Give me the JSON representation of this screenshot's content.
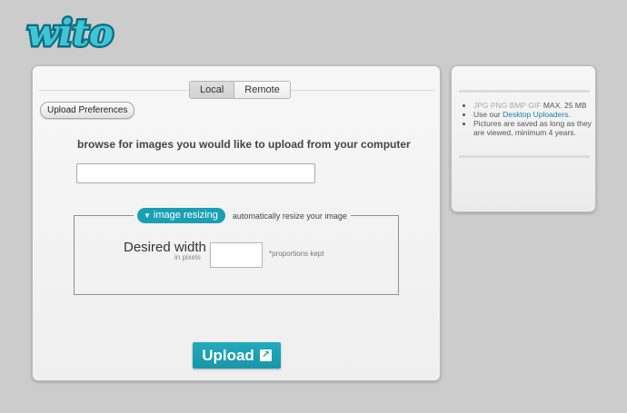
{
  "logo": {
    "text": "wito"
  },
  "tabs": [
    {
      "label": "Local",
      "active": true
    },
    {
      "label": "Remote",
      "active": false
    }
  ],
  "upload_preferences": "Upload Preferences",
  "browse_label": "browse for images you would like to upload from your computer",
  "resize": {
    "pill_label": "image resizing",
    "note": "automatically resize your image",
    "width_label": "Desired width",
    "width_sub": "in pixels",
    "proportions": "*proportions kept",
    "width_value": ""
  },
  "upload_button": "Upload",
  "side": {
    "formats": "JPG PNG BMP GIF",
    "max_size": "MAX. 25 MB",
    "uploaders_prefix": "Use our ",
    "uploaders_link": "Desktop Uploaders",
    "uploaders_suffix": ".",
    "saved_note": "Pictures are saved as long as they are viewed, minimum 4 years."
  },
  "colors": {
    "accent": "#1a9fb3",
    "background": "#cccccc",
    "link": "#1a7fa8"
  }
}
